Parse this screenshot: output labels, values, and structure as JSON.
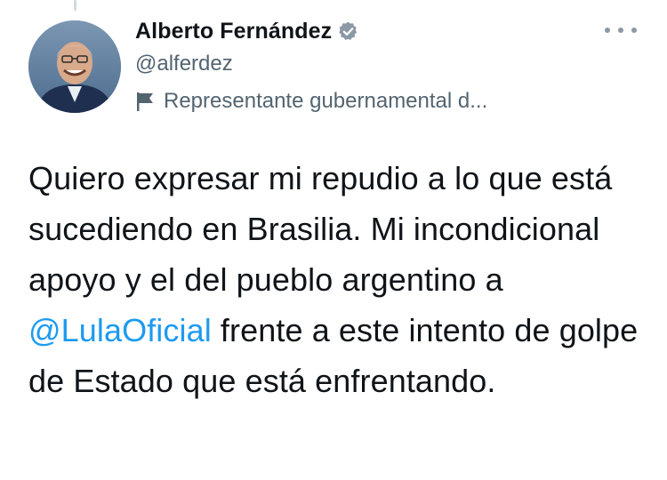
{
  "author": {
    "display_name": "Alberto Fernández",
    "handle": "@alferdez",
    "verified_icon": "verified-badge-icon",
    "affiliation_icon": "flag-icon",
    "affiliation_label": "Representante gubernamental d..."
  },
  "menu": {
    "more_icon": "more-horizontal-icon"
  },
  "tweet": {
    "text_before_mention": "Quiero expresar mi repudio a lo que está sucediendo en Brasilia. Mi incondicional apoyo y el del pueblo argentino a ",
    "mention": "@LulaOficial",
    "text_after_mention": " frente a este intento de golpe de Estado que está enfrentando."
  },
  "colors": {
    "text": "#0f1419",
    "secondary_text": "#536471",
    "link": "#1d9bf0",
    "verified": "#8b98a5"
  }
}
